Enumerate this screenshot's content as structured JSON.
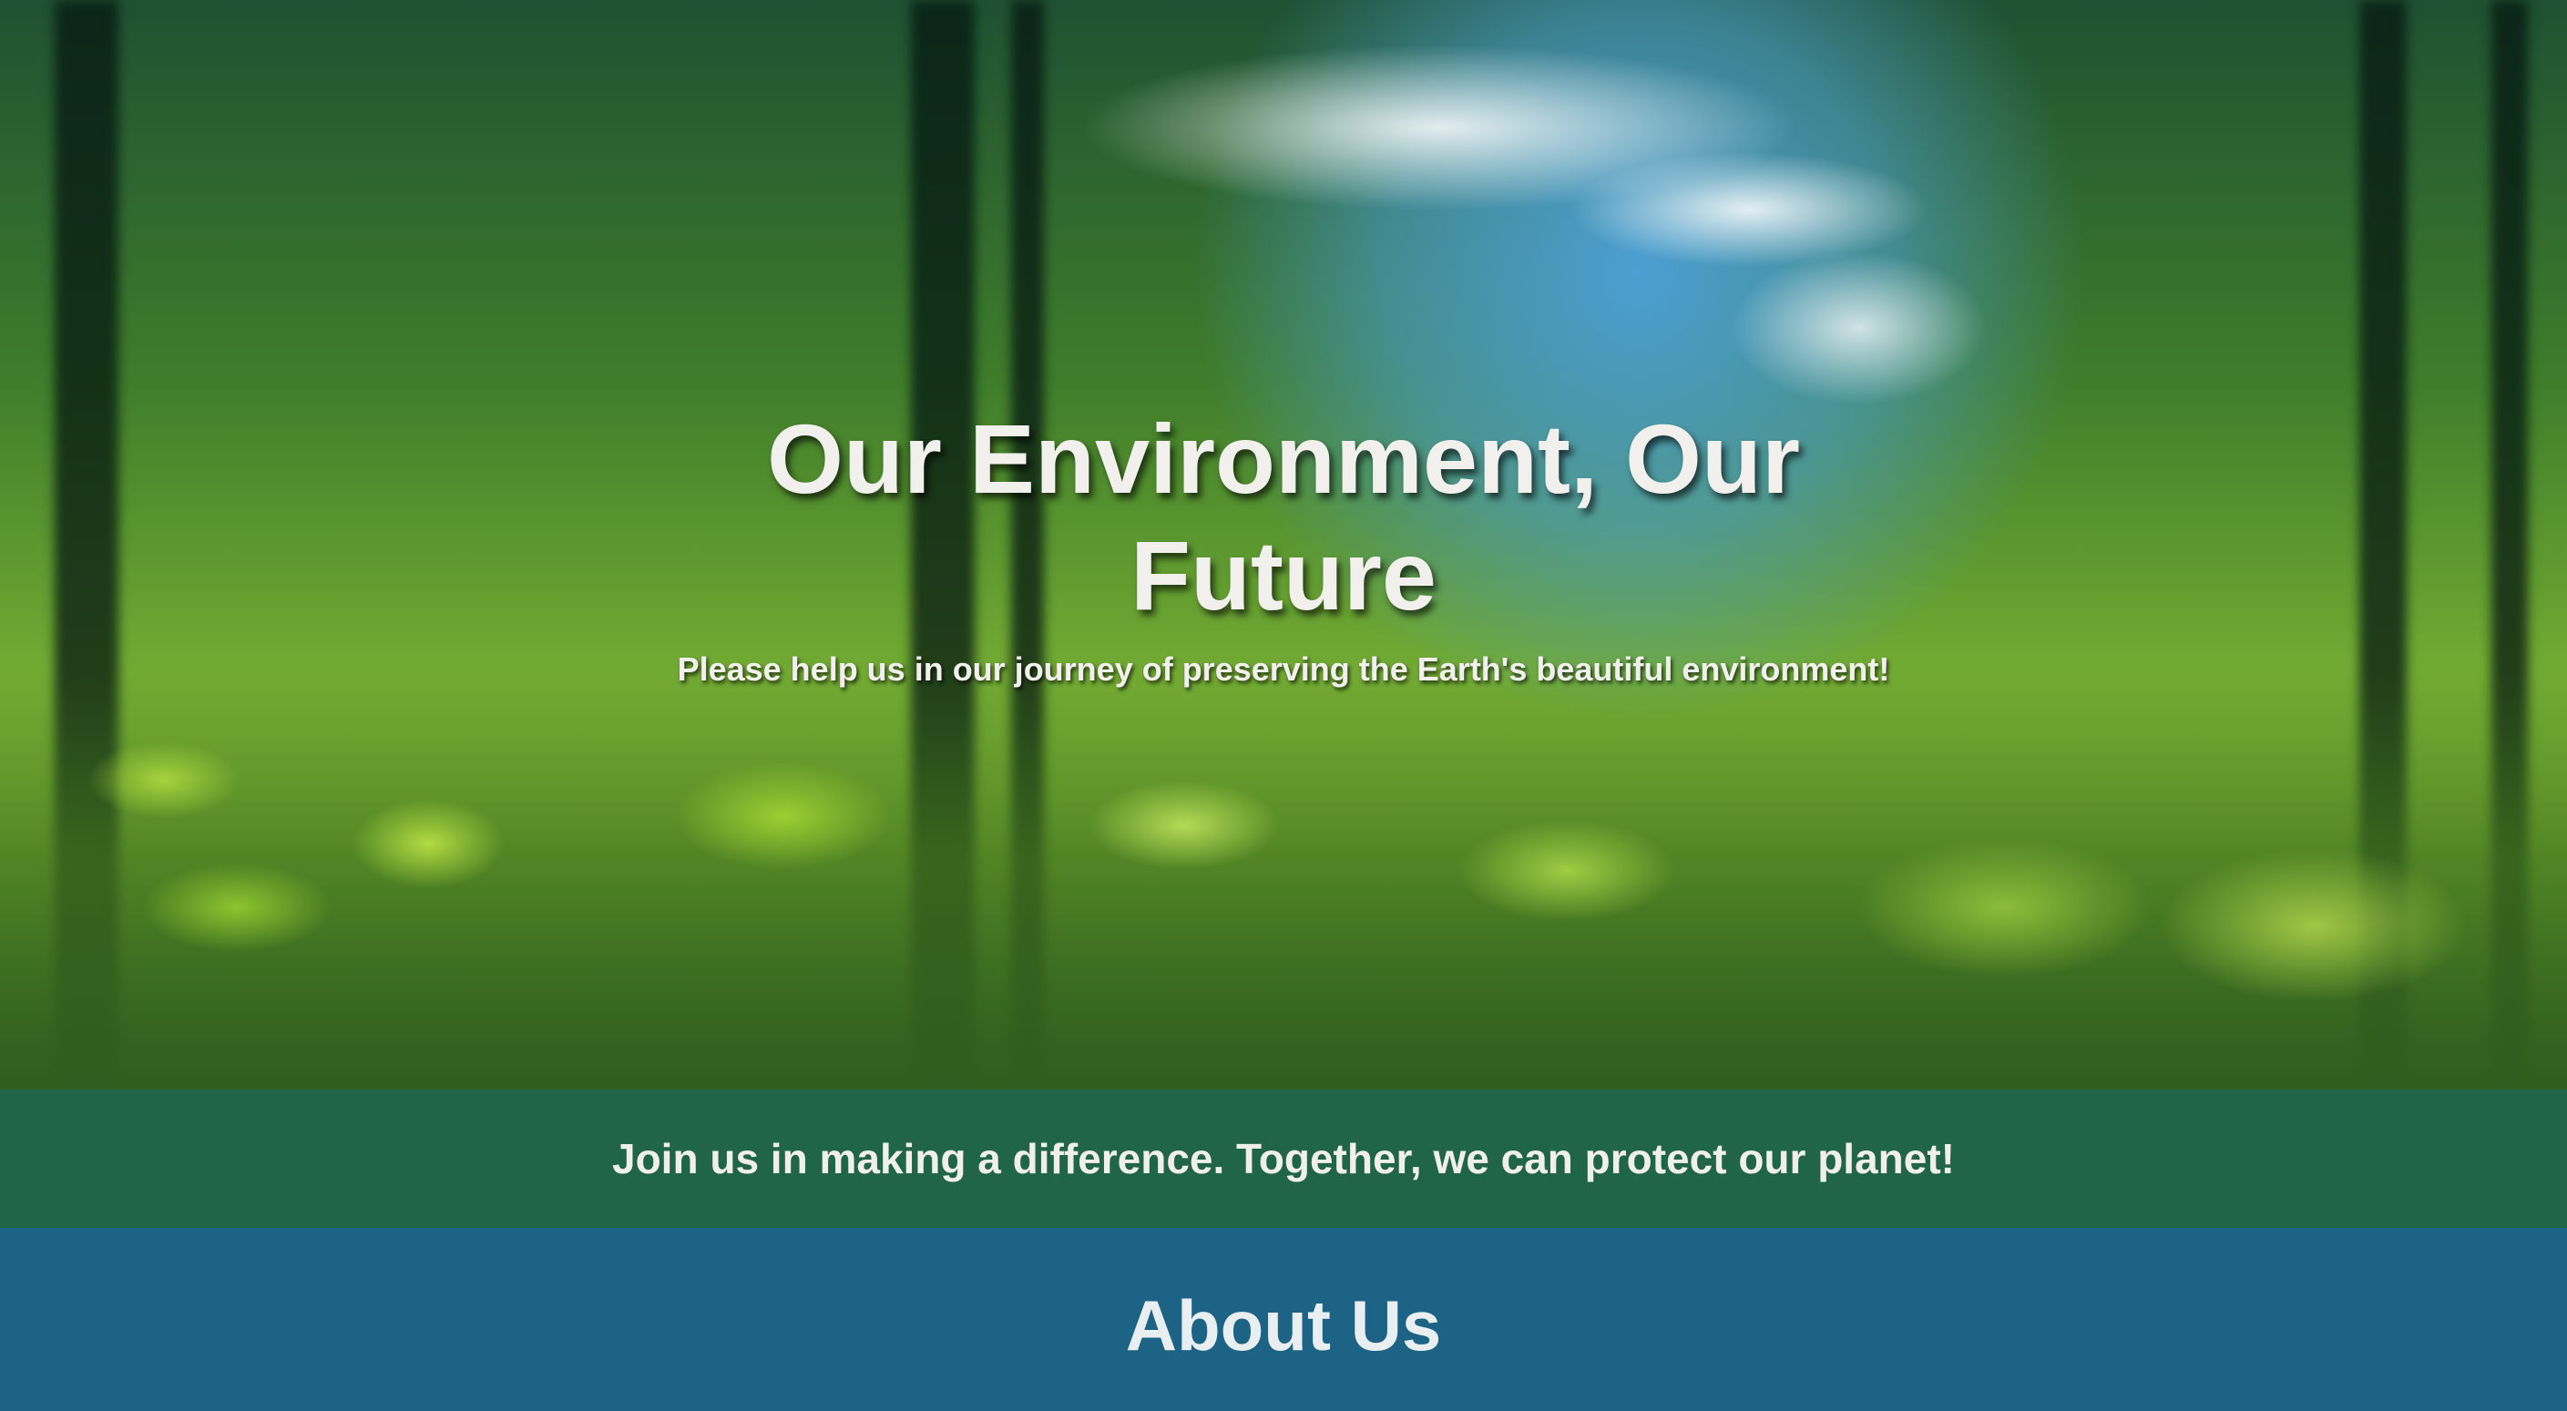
{
  "hero": {
    "title": "Our Environment, Our Future",
    "subtitle": "Please help us in our journey of preserving the Earth's beautiful environment!"
  },
  "cta": {
    "text": "Join us in making a difference. Together, we can protect our planet!"
  },
  "about": {
    "heading": "About Us"
  },
  "colors": {
    "cta_band": "#206548",
    "about_band": "#1d6385",
    "text_light": "#f2f0ec"
  }
}
